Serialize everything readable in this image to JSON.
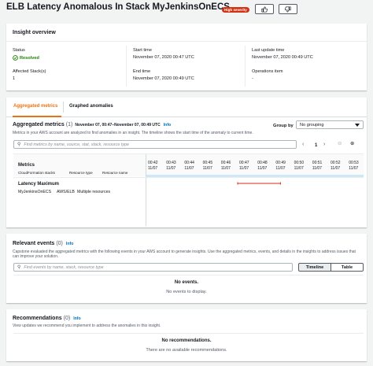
{
  "header": {
    "title": "ELB Latency Anomalous In Stack MyJenkinsOnECS",
    "severity_badge": "High severity"
  },
  "overview": {
    "heading": "Insight overview",
    "status_label": "Status",
    "status_value": "Resolved",
    "start_label": "Start time",
    "start_value": "November 07, 2020 00:47 UTC",
    "last_update_label": "Last update time",
    "last_update_value": "November 07, 2020 00:49 UTC",
    "affected_label": "Affected Stack(s)",
    "affected_value": "1",
    "end_label": "End time",
    "end_value": "November 07, 2020 00:49 UTC",
    "ops_label": "Operations item",
    "ops_value": "-"
  },
  "tabs": [
    {
      "label": "Aggregated metrics"
    },
    {
      "label": "Graphed anomalies"
    }
  ],
  "metrics": {
    "heading": "Aggregated metrics",
    "count": "(1)",
    "range": "November 07, 00:47–November 07, 00:49 UTC",
    "info": "Info",
    "description": "Metrics in your AWS account are analyzed to find anomalies in an insight. The timeline shows the start time of the anomaly to current time.",
    "group_by_label": "Group by",
    "group_by_value": "No grouping",
    "search_placeholder": "Find metrics by name, source, stat, stack, resource type",
    "page": "1",
    "col_metrics": "Metrics",
    "sub_cf": "CloudFormation stacks",
    "sub_rt": "Resource type",
    "sub_rn": "Resource name",
    "ticks": [
      {
        "time": "00:42",
        "date": "11/07"
      },
      {
        "time": "00:43",
        "date": "11/07"
      },
      {
        "time": "00:44",
        "date": "11/07"
      },
      {
        "time": "00:45",
        "date": "11/07"
      },
      {
        "time": "00:46",
        "date": "11/07"
      },
      {
        "time": "00:47",
        "date": "11/07"
      },
      {
        "time": "00:48",
        "date": "11/07"
      },
      {
        "time": "00:49",
        "date": "11/07"
      },
      {
        "time": "00:50",
        "date": "11/07"
      },
      {
        "time": "00:51",
        "date": "11/07"
      },
      {
        "time": "00:52",
        "date": "11/07"
      },
      {
        "time": "00:53",
        "date": "11/07"
      }
    ],
    "row": {
      "name": "Latency Maximum",
      "stack": "MyJenkinsOnECS",
      "type": "AWS/ELB",
      "resource": "Multiple resources"
    },
    "anomaly_color": "#d13212"
  },
  "events": {
    "heading": "Relevant events",
    "count": "(0)",
    "info": "Info",
    "description": "Capstone evaluated the aggregated metrics with the following events in your AWS account to generate insights. Use the aggregated metrics, events, and details in the insights to address issues that can improve your solution.",
    "search_placeholder": "Find events by name, stack, resource type",
    "timeline_label": "Timeline",
    "table_label": "Table",
    "empty_title": "No events.",
    "empty_sub": "No events to display."
  },
  "recommendations": {
    "heading": "Recommendations",
    "count": "(0)",
    "info": "Info",
    "description": "View updates we recommend you implement to address the anomalies in this insight.",
    "empty_title": "No recommendations.",
    "empty_sub": "There are no available recommendations."
  },
  "colors": {
    "accent": "#ec7211",
    "link": "#0073bb",
    "success": "#1d8102",
    "danger": "#d13212"
  }
}
